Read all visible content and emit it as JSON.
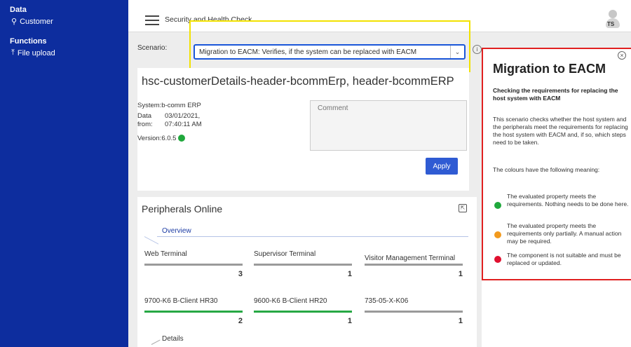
{
  "sidebar": {
    "data_section": "Data",
    "customer_label": "Customer",
    "functions_section": "Functions",
    "file_upload_label": "File upload"
  },
  "header": {
    "title": "Security and Health Check",
    "avatar_initials": "TS"
  },
  "scenario": {
    "label": "Scenario:",
    "selected": "Migration to EACM: Verifies, if the system can be replaced with EACM"
  },
  "details": {
    "title": "hsc-customerDetails-header-bcommErp, header-bcommERP",
    "system": "System:b-comm ERP",
    "data_from_label1": "Data",
    "data_from_label2": "from:",
    "date": "03/01/2021,",
    "time": "07:40:11 AM",
    "version": "Version:6.0.5",
    "comment_placeholder": "Comment",
    "apply_label": "Apply"
  },
  "peripherals": {
    "title": "Peripherals Online",
    "overview_tab": "Overview",
    "details_tab": "Details",
    "tiles": [
      {
        "name": "Web Terminal",
        "value": "3"
      },
      {
        "name": "Supervisor Terminal",
        "value": "1"
      },
      {
        "name": "Visitor Management Terminal",
        "value": "1"
      },
      {
        "name": "9700-K6 B-Client HR30",
        "value": "2"
      },
      {
        "name": "9600-K6 B-Client HR20",
        "value": "1"
      },
      {
        "name": "735-05-X-K06",
        "value": "1"
      }
    ]
  },
  "info_panel": {
    "title": "Migration to EACM",
    "subtitle": "Checking the requirements for replacing the host system with EACM",
    "description": "This scenario checks whether the host system and the peripherals meet the requirements for replacing the host system with EACM and, if so, which steps need to be taken.",
    "colors_intro": "The colours have the following meaning:",
    "legend": [
      {
        "text": "The evaluated property meets the requirements. Nothing needs to be done here.",
        "color": "#20a83c"
      },
      {
        "text": "The evaluated property meets the requirements only partially. A manual action may be required.",
        "color": "#f29a1e"
      },
      {
        "text": "The component is not suitable and must be replaced or updated.",
        "color": "#e0102f"
      }
    ]
  },
  "colors": {
    "sidebar_bg": "#0d2d9e",
    "accent": "#2f5bd3",
    "status_ok": "#20a83c"
  }
}
